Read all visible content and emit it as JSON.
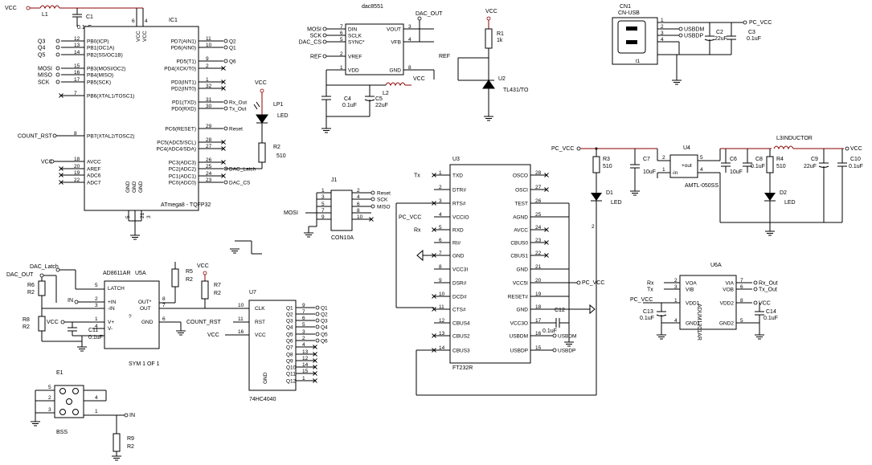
{
  "ic1": {
    "ref": "IC1",
    "name": "ATmega8 - TQFP32",
    "left_pins": [
      {
        "num": "12",
        "name": "PB0(ICP)",
        "net": "Q3"
      },
      {
        "num": "13",
        "name": "PB1(OC1A)",
        "net": "Q4"
      },
      {
        "num": "14",
        "name": "PB2(SS/OC1B)",
        "net": "Q5"
      },
      {
        "num": "15",
        "name": "PB3(MOSI/OC2)",
        "net": "MOSI"
      },
      {
        "num": "16",
        "name": "PB4(MISO)",
        "net": "MISO"
      },
      {
        "num": "17",
        "name": "PB5(SCK)",
        "net": "SCK"
      },
      {
        "num": "7",
        "name": "PB6(XTAL1/TOSC1)",
        "net": ""
      },
      {
        "num": "8",
        "name": "PB7(XTAL2/TOSC2)",
        "net": "COUNT_RST"
      },
      {
        "num": "18",
        "name": "AVCC",
        "net": "VCC"
      },
      {
        "num": "20",
        "name": "AREF",
        "net": ""
      },
      {
        "num": "19",
        "name": "ADC6",
        "net": ""
      },
      {
        "num": "22",
        "name": "ADC7",
        "net": ""
      }
    ],
    "right_pins": [
      {
        "num": "11",
        "name": "PD7(AIN1)",
        "net": "Q2"
      },
      {
        "num": "10",
        "name": "PD6(AIN0)",
        "net": "Q1"
      },
      {
        "num": "9",
        "name": "PD5(T1)",
        "net": "Q6"
      },
      {
        "num": "2",
        "name": "PD4(XCK/T0)",
        "net": ""
      },
      {
        "num": "1",
        "name": "PD3(INT1)",
        "net": ""
      },
      {
        "num": "32",
        "name": "PD2(INT0)",
        "net": ""
      },
      {
        "num": "31",
        "name": "PD1(TXD)",
        "net": "Rx_Out"
      },
      {
        "num": "30",
        "name": "PD0(RXD)",
        "net": "Tx_Out"
      },
      {
        "num": "29",
        "name": "PC6(RESET)",
        "net": "Reset"
      },
      {
        "num": "28",
        "name": "PC5(ADC5/SCL)",
        "net": ""
      },
      {
        "num": "27",
        "name": "PC4(ADC4/SDA)",
        "net": ""
      },
      {
        "num": "26",
        "name": "PC3(ADC3)",
        "net": ""
      },
      {
        "num": "25",
        "name": "PC2(ADC2)",
        "net": "DAC_Latch"
      },
      {
        "num": "24",
        "name": "PC1(ADC1)",
        "net": ""
      },
      {
        "num": "23",
        "name": "PC0(ADC0)",
        "net": "DAC_CS"
      }
    ],
    "top_pins": [
      "VCC",
      "VCC"
    ],
    "top_nums": [
      "6",
      "4"
    ],
    "bottom_pins": [
      "GND",
      "GND",
      "GND"
    ],
    "bottom_nums": [
      "5",
      "21",
      "3"
    ]
  },
  "dac": {
    "ref": "dac8551",
    "left_pins": [
      {
        "num": "7",
        "name": "DIN",
        "net": "MOSI"
      },
      {
        "num": "6",
        "name": "SCLK",
        "net": "SCK"
      },
      {
        "num": "5",
        "name": "SYNC*",
        "net": "DAC_CS"
      },
      {
        "num": "2",
        "name": "VREF",
        "net": "REF"
      },
      {
        "num": "1",
        "name": "VDD",
        "net": ""
      }
    ],
    "right_pins": [
      {
        "num": "3",
        "name": "VOUT",
        "net": ""
      },
      {
        "num": "4",
        "name": "VFB",
        "net": "DAC_OUT"
      },
      {
        "num": "8",
        "name": "GND",
        "net": ""
      }
    ]
  },
  "ref_circuit": {
    "vcc": "VCC",
    "r1": "R1",
    "r1_val": "1k",
    "u2": "U2",
    "u2_part": "TL431/TO",
    "ref": "REF"
  },
  "cn1": {
    "ref": "CN1",
    "part": "CN-USB",
    "pins": [
      "1",
      "2",
      "3",
      "4"
    ],
    "nets": [
      "USBDM",
      "USBDP"
    ],
    "shield": "t1",
    "c2": "C2",
    "c2_val": "22uF",
    "c3": "C3",
    "c3_val": "0.1uF",
    "pc_vcc": "PC_VCC"
  },
  "u3": {
    "ref": "U3",
    "part": "FT232R",
    "left_pins": [
      {
        "num": "1",
        "name": "TXD",
        "net": "Tx"
      },
      {
        "num": "2",
        "name": "DTR#",
        "net": ""
      },
      {
        "num": "3",
        "name": "RTS#",
        "net": ""
      },
      {
        "num": "4",
        "name": "VCCIO",
        "net": "PC_VCC"
      },
      {
        "num": "5",
        "name": "RXD",
        "net": "Rx"
      },
      {
        "num": "6",
        "name": "RI#",
        "net": ""
      },
      {
        "num": "7",
        "name": "GND",
        "net": ""
      },
      {
        "num": "8",
        "name": "VCC3I",
        "net": ""
      },
      {
        "num": "9",
        "name": "DSR#",
        "net": ""
      },
      {
        "num": "10",
        "name": "DCD#",
        "net": ""
      },
      {
        "num": "11",
        "name": "CTS#",
        "net": ""
      },
      {
        "num": "12",
        "name": "CBUS4",
        "net": ""
      },
      {
        "num": "13",
        "name": "CBUS2",
        "net": ""
      },
      {
        "num": "14",
        "name": "CBUS3",
        "net": ""
      }
    ],
    "right_pins": [
      {
        "num": "28",
        "name": "OSCO",
        "net": ""
      },
      {
        "num": "27",
        "name": "OSCI",
        "net": ""
      },
      {
        "num": "26",
        "name": "TEST",
        "net": ""
      },
      {
        "num": "25",
        "name": "AGND",
        "net": ""
      },
      {
        "num": "24",
        "name": "AVCC",
        "net": ""
      },
      {
        "num": "23",
        "name": "CBUS0",
        "net": ""
      },
      {
        "num": "22",
        "name": "CBUS1",
        "net": ""
      },
      {
        "num": "21",
        "name": "GND",
        "net": ""
      },
      {
        "num": "20",
        "name": "VCC5I",
        "net": "PC_VCC"
      },
      {
        "num": "19",
        "name": "RESET#",
        "net": ""
      },
      {
        "num": "18",
        "name": "GND",
        "net": ""
      },
      {
        "num": "17",
        "name": "VCC3O",
        "net": ""
      },
      {
        "num": "16",
        "name": "USBDM",
        "net": "USBDM"
      },
      {
        "num": "15",
        "name": "USBDP",
        "net": "USBDP"
      }
    ],
    "c12": "C12",
    "c12_val": "0.1uF"
  },
  "j1": {
    "ref": "J1",
    "part": "CON10A",
    "left_nums": [
      "1",
      "3",
      "5",
      "7",
      "9"
    ],
    "right_nums": [
      "2",
      "4",
      "6",
      "8",
      "10"
    ],
    "right_nets": [
      "Reset",
      "SCK",
      "MISO"
    ],
    "left_net": "MOSI"
  },
  "lp1": {
    "vcc": "VCC",
    "ref": "LP1",
    "part": "LED",
    "r2": "R2",
    "r2_val": "510"
  },
  "power": {
    "pc_vcc": "PC_VCC",
    "vcc": "VCC",
    "r3": "R3",
    "r3_val": "510",
    "d1": "D1",
    "d1_part": "LED",
    "c7": "C7",
    "c7_val": "10uF",
    "u4": "U4",
    "u4_part": "AMTL-050SS",
    "u4_in": "+in",
    "u4_out": "+out",
    "u4_gin": "-in",
    "u4_gout": "-out",
    "u4_pins": [
      "1",
      "2",
      "5",
      "4"
    ],
    "c6": "C6",
    "c6_val": "10uF",
    "c8": "C8",
    "c8_val": "0.1uF",
    "r4": "R4",
    "r4_val": "510",
    "d2": "D2",
    "d2_part": "LED",
    "l3": "L3",
    "l3_part": "INDUCTOR",
    "c9": "C9",
    "c9_val": "22uF",
    "c10": "C10",
    "c10_val": "0.1uF"
  },
  "u6": {
    "ref": "U6A",
    "part": "ADUM1201AR",
    "left_pins": [
      {
        "num": "2",
        "name": "VOA",
        "net": "Rx"
      },
      {
        "num": "3",
        "name": "VIB",
        "net": "Tx"
      },
      {
        "num": "1",
        "name": "VDD1",
        "net": "PC_VCC"
      },
      {
        "num": "4",
        "name": "GND1",
        "net": ""
      }
    ],
    "right_pins": [
      {
        "num": "7",
        "name": "VIA",
        "net": "Rx_Out"
      },
      {
        "num": "6",
        "name": "VOB",
        "net": "Tx_Out"
      },
      {
        "num": "8",
        "name": "VDD2",
        "net": "VCC"
      },
      {
        "num": "5",
        "name": "GND2",
        "net": ""
      }
    ],
    "c13": "C13",
    "c13_val": "0.1uF",
    "c14": "C14",
    "c14_val": "0.1uF"
  },
  "top_left": {
    "vcc": "VCC",
    "l1": "L1",
    "c1": "C1",
    "c1_val": "0.1uF"
  },
  "ad8611": {
    "ref": "U5A",
    "part": "AD8611AR",
    "pins": {
      "latch": "LATCH",
      "inp": "+IN",
      "inn": "-IN",
      "vp": "V+",
      "vm": "V-",
      "outp": "OUT*",
      "out": "OUT",
      "gnd": "GND",
      "q": "?"
    },
    "nums": {
      "latch": "5",
      "inp": "2",
      "inn": "3",
      "vp": "1",
      "vm": "4",
      "outp": "8",
      "out": "7",
      "gnd": "6"
    },
    "footer": "SYM 1 OF 1",
    "dac_latch": "DAC_Latch",
    "dac_out": "DAC_OUT",
    "in": "IN",
    "vcc": "VCC",
    "r5": "R5",
    "r5_val": "R2",
    "r6": "R6",
    "r6_val": "R2",
    "r7": "R7",
    "r7_val": "R2",
    "r8": "R8",
    "r8_val": "R2",
    "c11": "C11",
    "c11_val": "0.1uF"
  },
  "u7": {
    "ref": "U7",
    "part": "74HC4040",
    "left_pins": [
      {
        "num": "10",
        "name": "CLK"
      },
      {
        "num": "11",
        "name": "RST",
        "net": "COUNT_RST"
      },
      {
        "num": "16",
        "name": "VCC",
        "net": "VCC"
      }
    ],
    "outputs": [
      {
        "num": "9",
        "name": "Q1",
        "net": "Q1"
      },
      {
        "num": "7",
        "name": "Q2",
        "net": "Q2"
      },
      {
        "num": "6",
        "name": "Q3",
        "net": "Q3"
      },
      {
        "num": "5",
        "name": "Q4",
        "net": "Q4"
      },
      {
        "num": "3",
        "name": "Q5",
        "net": "Q5"
      },
      {
        "num": "2",
        "name": "Q6",
        "net": "Q6"
      },
      {
        "num": "4",
        "name": "Q7",
        "net": ""
      },
      {
        "num": "13",
        "name": "Q8",
        "net": ""
      },
      {
        "num": "12",
        "name": "Q9",
        "net": ""
      },
      {
        "num": "14",
        "name": "Q10",
        "net": ""
      },
      {
        "num": "15",
        "name": "Q11",
        "net": ""
      },
      {
        "num": "1",
        "name": "Q12",
        "net": ""
      }
    ],
    "gnd": "GND",
    "gnd_num": "8"
  },
  "e1": {
    "ref": "E1",
    "part": "BSS",
    "pins": [
      "5",
      "2",
      "3",
      "4",
      "1"
    ],
    "in": "IN",
    "r9": "R9",
    "r9_val": "R2"
  }
}
